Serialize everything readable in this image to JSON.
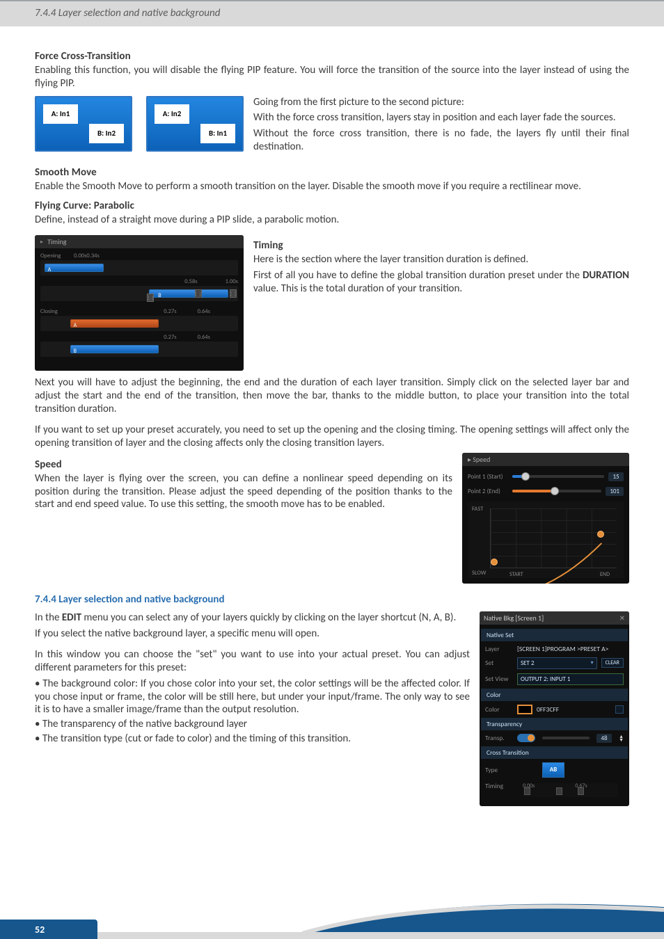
{
  "header": {
    "breadcrumb": "7.4.4 Layer selection and native background"
  },
  "force_cross": {
    "title": "Force Cross-Transition",
    "p1": "Enabling this function, you will disable the flying PIP feature. You will force the transition of the source into the layer instead of using the flying PIP.",
    "box1": {
      "a": "A: In1",
      "b": "B: In2"
    },
    "box2": {
      "a": "A: In2",
      "b": "B: In1"
    },
    "side1": "Going from the first picture to the second picture:",
    "side2": "With the force cross transition, layers stay in position and each layer fade the sources.",
    "side3": "Without the force cross transition, there is no fade, the layers fly until their final destination."
  },
  "smooth": {
    "title": "Smooth Move",
    "p": "Enable the Smooth Move to perform a smooth transition on the layer. Disable the smooth move if you require a rectilinear move."
  },
  "flying": {
    "title": "Flying Curve: Parabolic",
    "p": "Define, instead of a straight move during a PIP slide, a parabolic motion."
  },
  "timing": {
    "panel_title": "Timing",
    "opening": "Opening",
    "closing": "Closing",
    "times": {
      "t0": "0.00s",
      "t034": "0.34s",
      "t058": "0.58s",
      "t100": "1.00s",
      "c1a": "0.27s",
      "c1b": "0.64s",
      "c2a": "0.27s",
      "c2b": "0.64s"
    },
    "letters": {
      "a": "A",
      "b": "B"
    },
    "head": "Timing",
    "p1": "Here is the section where the layer transition duration is defined.",
    "p2a": "First of all you have to define the global transition duration preset under the ",
    "p2b": "DURATION",
    "p2c": " value. This is the total duration of your transition."
  },
  "timing_para1": "Next you will have to adjust the beginning, the end and the duration of each layer transition. Simply click on the selected layer bar and adjust the start and the end of the transition, then move the bar, thanks to the middle button, to place your transition into the total transition duration.",
  "timing_para2": "If you want to set up your preset accurately, you need to set up the opening and the closing timing. The opening settings will affect only the opening transition of layer and the closing affects only the closing transition layers.",
  "speed": {
    "panel_title": "Speed",
    "title": "Speed",
    "p": "When the layer is flying over the screen, you can define a nonlinear speed depending on its position during the transition. Please adjust the speed depending of the position thanks to the start and end speed value. To use this setting, the smooth move has to be enabled.",
    "p1_label": "Point 1 (Start)",
    "p1_val": "15",
    "p2_label": "Point 2 (End)",
    "p2_val": "101",
    "fast": "FAST",
    "slow": "SLOW",
    "start": "START",
    "end": "END"
  },
  "section_744": {
    "heading": "7.4.4 Layer selection and native background",
    "p1a": "In the ",
    "p1b": "EDIT",
    "p1c": " menu you can select any of your layers quickly by clicking on the layer shortcut (N, A, B).",
    "p2": "If you select the native background layer, a specific menu will open.",
    "p3": "In this window you can choose the \"set\" you want to use into your actual preset. You can adjust different parameters for this preset:",
    "b1": "• The background color: If you chose color into your set, the color settings will be the affected color. If you chose input or frame, the color will be still here, but under your input/frame. The only way to see it is to have a smaller image/frame than the output resolution.",
    "b2": "• The transparency of the native background layer",
    "b3": "• The transition type (cut or fade to color) and the timing of this transition."
  },
  "native_panel": {
    "titlebar": "Native Bkg [Screen 1]",
    "sec_native": "Native Set",
    "layer_lab": "Layer",
    "layer_val": "[SCREEN 1]PROGRAM >PRESET A>",
    "set_lab": "Set",
    "set_val": "SET 2",
    "clear": "CLEAR",
    "setview_lab": "Set View",
    "setview_val": "OUTPUT 2: INPUT 1",
    "sec_color": "Color",
    "color_lab": "Color",
    "color_val": "0FF3CFF",
    "sec_trans": "Transparency",
    "transp_lab": "Transp.",
    "transp_val": "48",
    "sec_cross": "Cross Transition",
    "type_lab": "Type",
    "ab": "AB",
    "timing_lab": "Timing",
    "t0": "0.00s",
    "t1": "0.67s"
  },
  "footer": {
    "page_number": "52"
  }
}
